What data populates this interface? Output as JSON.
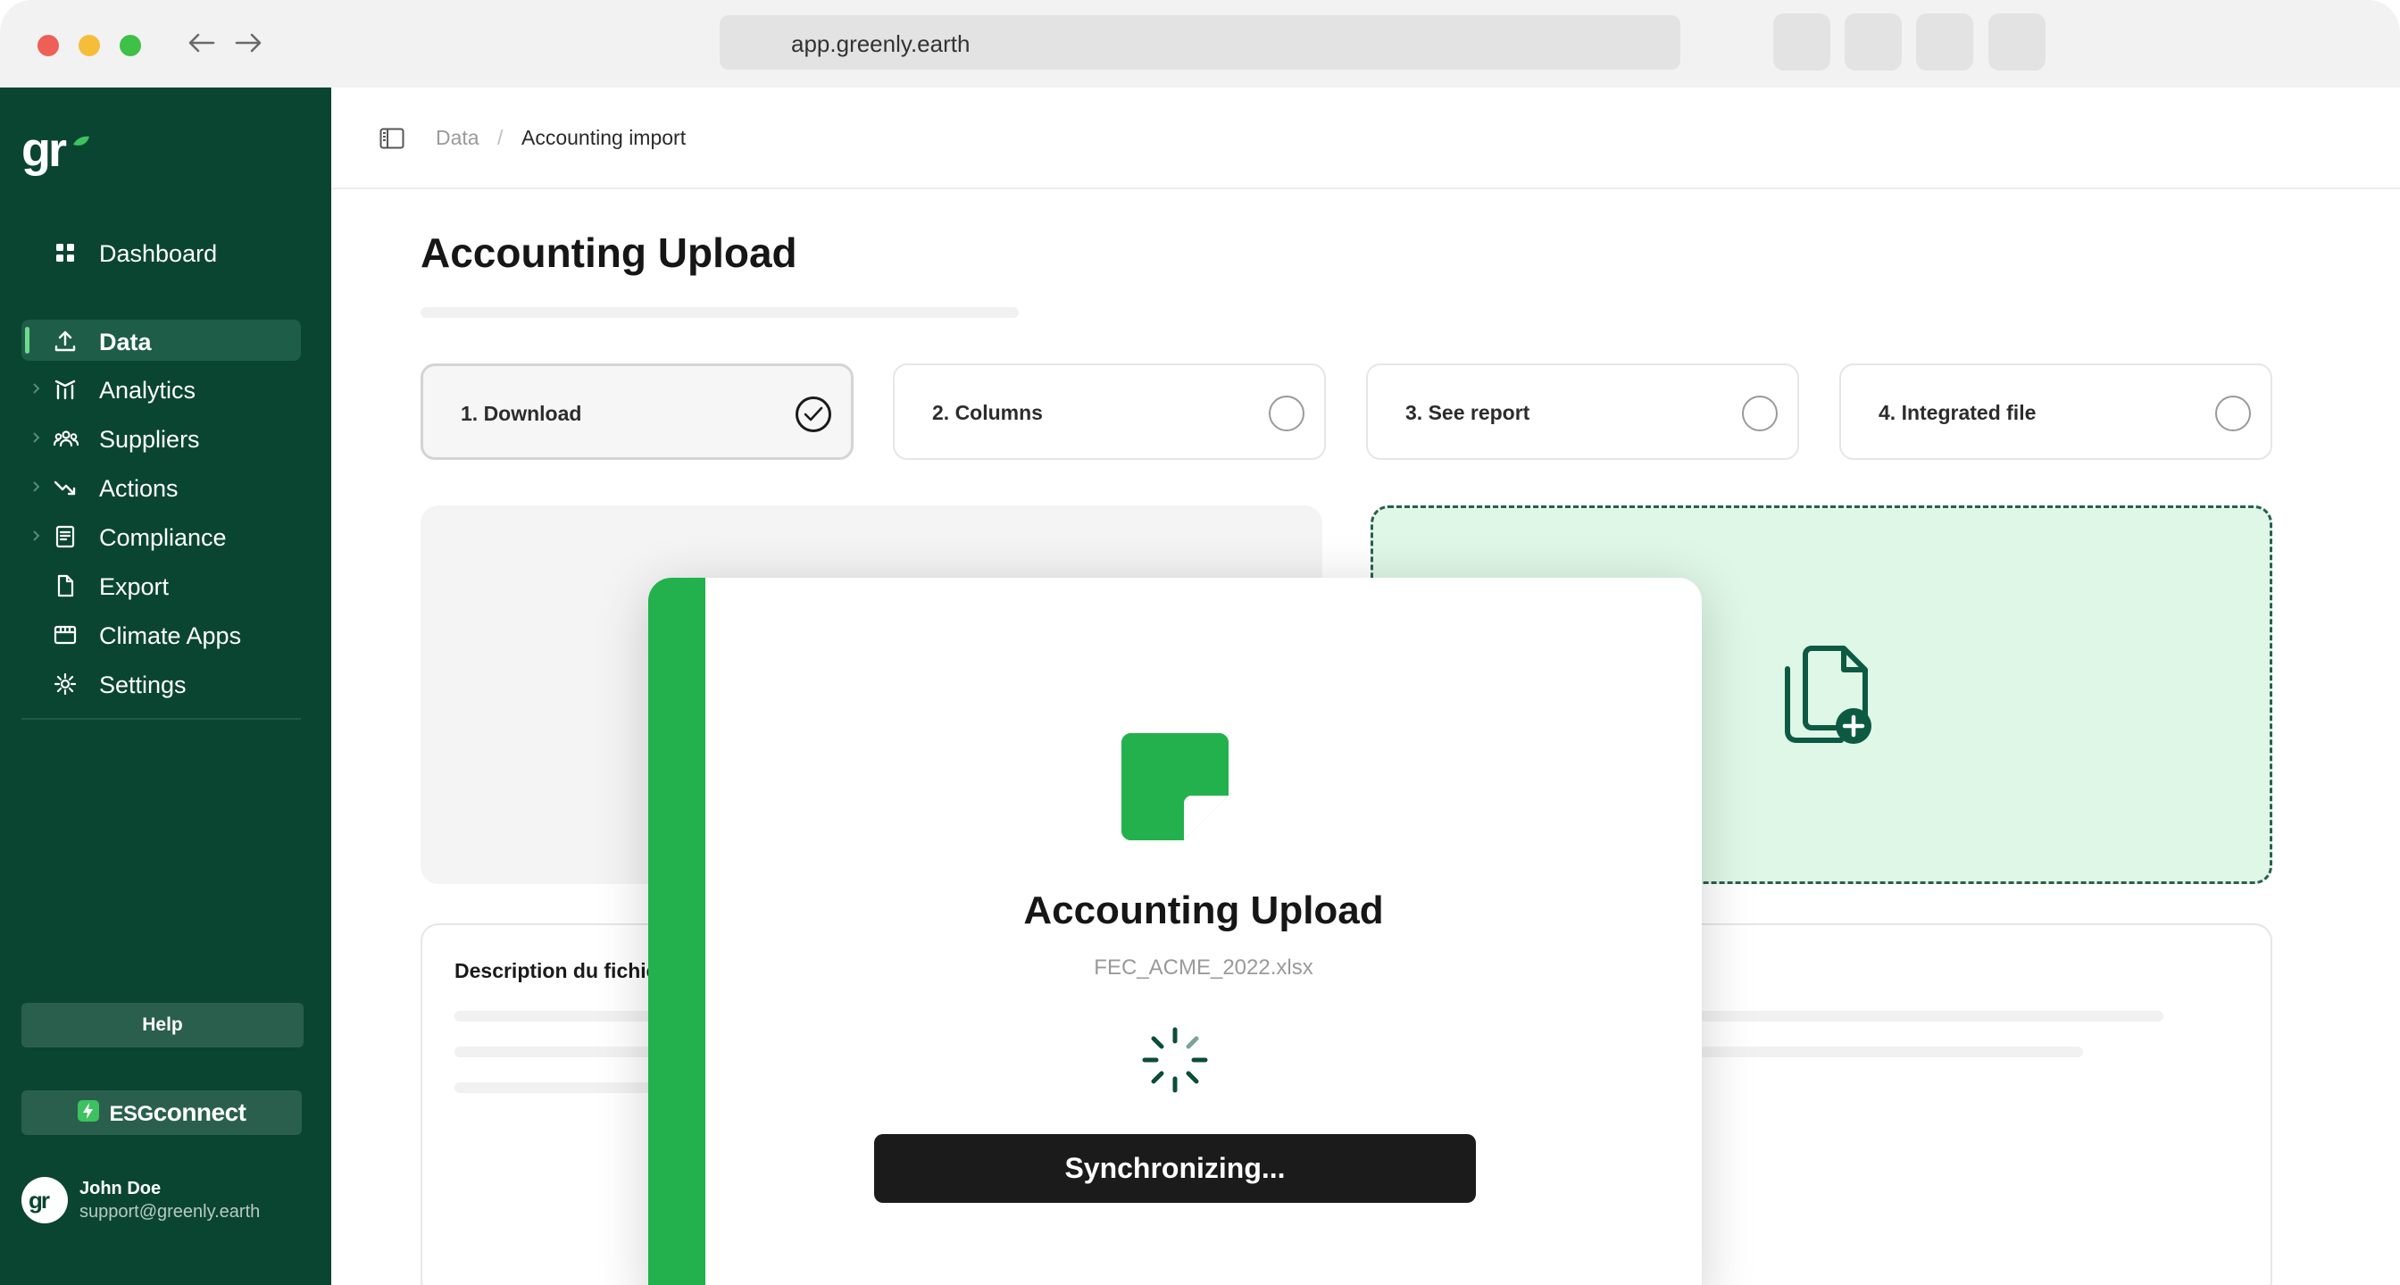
{
  "browser": {
    "url": "app.greenly.earth"
  },
  "sidebar": {
    "items": [
      {
        "label": "Dashboard"
      },
      {
        "label": "Data"
      },
      {
        "label": "Analytics"
      },
      {
        "label": "Suppliers"
      },
      {
        "label": "Actions"
      },
      {
        "label": "Compliance"
      },
      {
        "label": "Export"
      },
      {
        "label": "Climate Apps"
      },
      {
        "label": "Settings"
      }
    ],
    "help_label": "Help",
    "esg": {
      "part1": "ESG",
      "part2": "connect"
    },
    "user": {
      "name": "John Doe",
      "email": "support@greenly.earth"
    }
  },
  "breadcrumb": {
    "parent": "Data",
    "separator": "/",
    "current": "Accounting import"
  },
  "page": {
    "title": "Accounting Upload"
  },
  "steps": [
    {
      "label": "1. Download",
      "status": "done"
    },
    {
      "label": "2. Columns",
      "status": "pending"
    },
    {
      "label": "3. See report",
      "status": "pending"
    },
    {
      "label": "4. Integrated file",
      "status": "pending"
    }
  ],
  "description": {
    "title": "Description du fichier"
  },
  "modal": {
    "title": "Accounting Upload",
    "filename": "FEC_ACME_2022.xlsx",
    "button_label": "Synchronizing..."
  },
  "colors": {
    "sidebar_bg": "#0a4532",
    "accent_green": "#22b14c",
    "drop_zone_bg": "#dff7e7",
    "button_dark": "#1b1b1b"
  }
}
